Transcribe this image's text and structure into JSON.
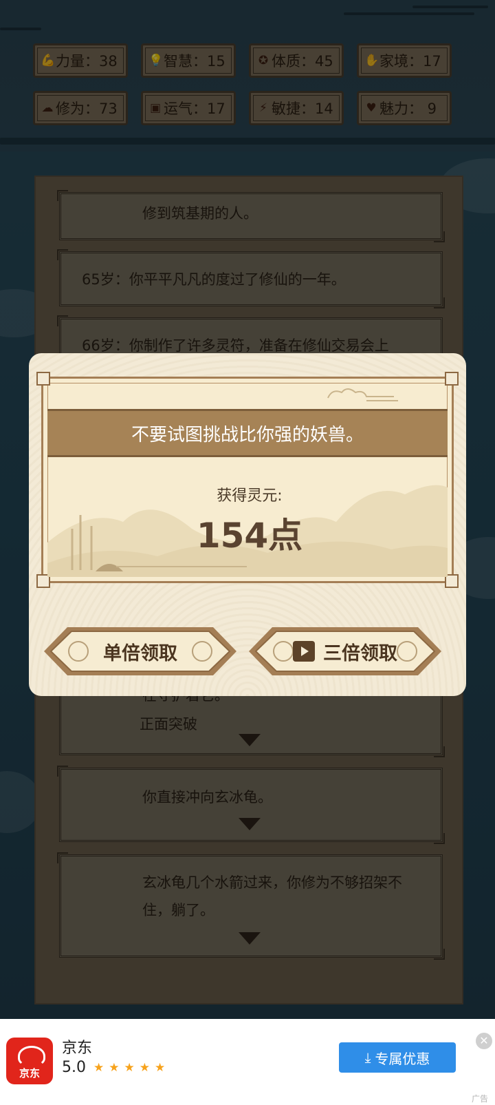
{
  "stats": [
    {
      "icon": "arm-icon",
      "glyph": "💪",
      "text": "力量：38"
    },
    {
      "icon": "bulb-icon",
      "glyph": "💡",
      "text": "智慧：15"
    },
    {
      "icon": "gear-icon",
      "glyph": "✪",
      "text": "体质：45"
    },
    {
      "icon": "hands-icon",
      "glyph": "✋",
      "text": "家境：17"
    },
    {
      "icon": "cloud-icon",
      "glyph": "☁",
      "text": "修为：73"
    },
    {
      "icon": "luck-icon",
      "glyph": "▣",
      "text": "运气：17"
    },
    {
      "icon": "lightning-icon",
      "glyph": "⚡",
      "text": "敏捷：14"
    },
    {
      "icon": "heart-icon",
      "glyph": "♥",
      "text": "魅力：  9"
    }
  ],
  "log": {
    "entries": [
      "修到筑基期的人。",
      "65岁：你平平凡凡的度过了修仙的一年。",
      "66岁：你制作了许多灵符，准备在修仙交易会上",
      "在守护着它。",
      "正面突破",
      "你直接冲向玄冰龟。",
      "玄冰龟几个水箭过来，你修为不够招架不住，躺了。"
    ]
  },
  "dialog": {
    "message": "不要试图挑战比你强的妖兽。",
    "gain_label": "获得灵元:",
    "gain_value": "154点",
    "single_button": "单倍领取",
    "triple_button": "三倍领取"
  },
  "ad": {
    "app_name": "京东",
    "logo_text": "京东",
    "rating": "5.0",
    "stars": 5,
    "button": "专属优惠",
    "tag": "广告",
    "accent": "#2f8ee8"
  }
}
